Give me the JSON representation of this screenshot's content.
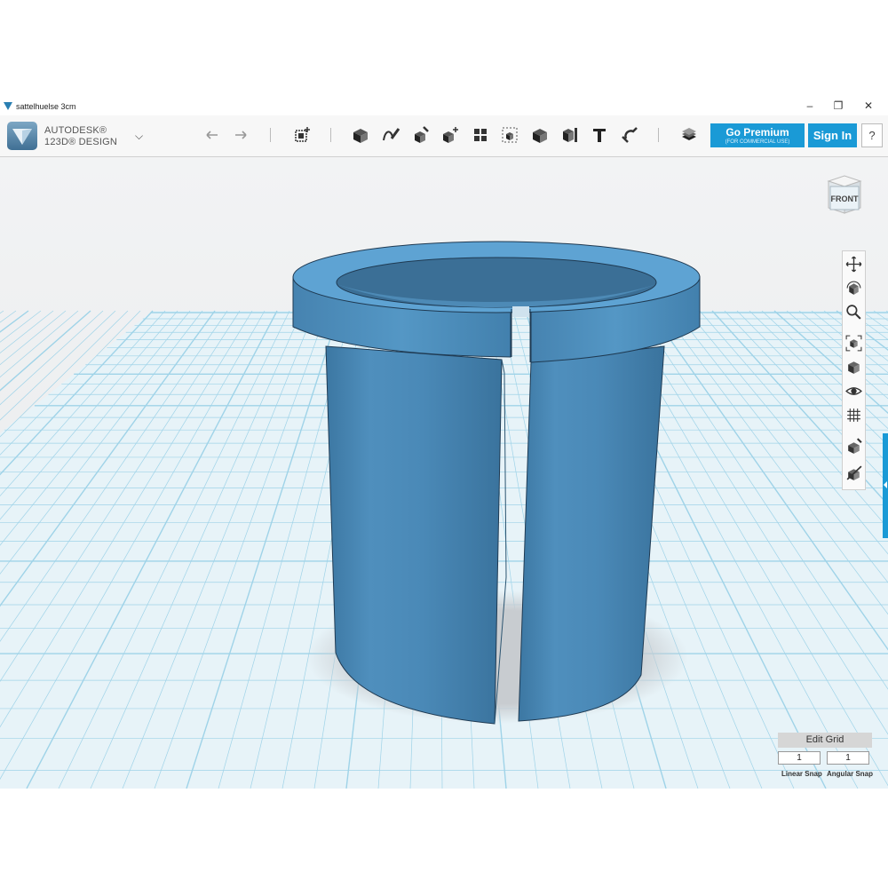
{
  "window": {
    "title": "sattelhuelse 3cm",
    "controls": [
      "–",
      "❐",
      "✕"
    ]
  },
  "app": {
    "brand_line1": "AUTODESK®",
    "brand_line2": "123D® DESIGN"
  },
  "toolbar": {
    "icons": [
      "undo-icon",
      "redo-icon",
      "transform-icon",
      "primitives-icon",
      "sketch-icon",
      "construct-icon",
      "modify-icon",
      "pattern-icon",
      "group-icon",
      "combine-icon",
      "measure-icon",
      "text-icon",
      "snap-icon",
      "material-icon"
    ],
    "go_premium_label": "Go Premium",
    "go_premium_sub": "(FOR COMMERCIAL USE)",
    "sign_in_label": "Sign In",
    "help_label": "?"
  },
  "viewcube": {
    "face_label": "FRONT"
  },
  "nav_toolbar": {
    "icons": [
      "pan-icon",
      "orbit-icon",
      "zoom-icon",
      "fit-icon",
      "view-mode-icon",
      "visibility-icon",
      "grid-icon",
      "material-icon",
      "hide-icon"
    ]
  },
  "grid_panel": {
    "edit_grid_label": "Edit Grid",
    "linear_snap_value": "1",
    "angular_snap_value": "1",
    "linear_snap_label": "Linear Snap",
    "angular_snap_label": "Angular Snap"
  },
  "colors": {
    "accent": "#1a9ad6",
    "model": "#4a88b5",
    "grid_line": "#9fd3e8",
    "background": "#eef0f1"
  }
}
